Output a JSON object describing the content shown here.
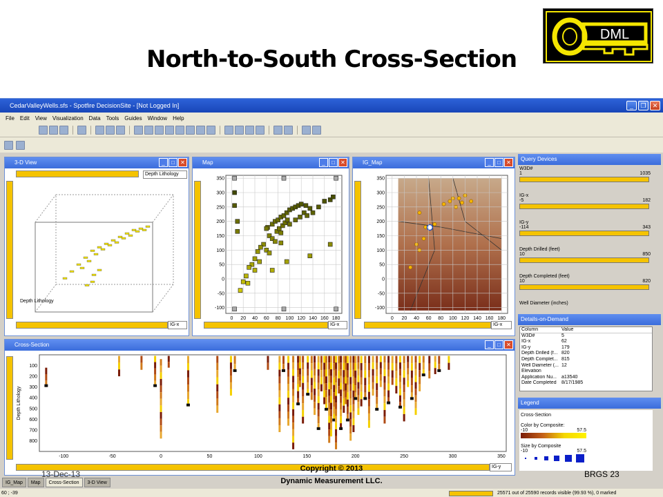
{
  "slide": {
    "title": "North-to-South Cross-Section",
    "logo_text": "DML",
    "footer_date": "13-Dec-13",
    "footer_copyright_line1": "Copyright © 2013",
    "footer_copyright_line2": "Dynamic Measurement LLC.",
    "footer_page": "BRGS  23"
  },
  "app": {
    "title": "CedarValleyWells.sfs - Spotfire DecisionSite - [Not Logged In]",
    "menu": [
      "File",
      "Edit",
      "View",
      "Visualization",
      "Data",
      "Tools",
      "Guides",
      "Window",
      "Help"
    ]
  },
  "panels": {
    "view3d": {
      "title": "3-D View",
      "color_by": "Depth Lithology",
      "x_axis": "IG-x",
      "z_label": "Depth Lithology"
    },
    "map": {
      "title": "Map",
      "x_axis": "IG-x",
      "y_axis": "IG-y"
    },
    "ig_map": {
      "title": "IG_Map",
      "x_axis": "IG-x",
      "y_axis": "IG-y"
    },
    "cross_section": {
      "title": "Cross-Section",
      "x_axis": "IG-y",
      "y_axis": "Depth Lithology"
    }
  },
  "chart_data": [
    {
      "type": "scatter",
      "title": "Map",
      "xlabel": "IG-x",
      "ylabel": "IG-y",
      "xlim": [
        -10,
        190
      ],
      "ylim": [
        -120,
        360
      ],
      "x_ticks": [
        0,
        20,
        40,
        60,
        80,
        100,
        120,
        140,
        160,
        180
      ],
      "y_ticks": [
        -100,
        -50,
        0,
        50,
        100,
        150,
        200,
        250,
        300,
        350
      ],
      "points": [
        [
          62,
          179
        ],
        [
          70,
          190
        ],
        [
          75,
          200
        ],
        [
          80,
          205
        ],
        [
          85,
          215
        ],
        [
          90,
          220
        ],
        [
          95,
          230
        ],
        [
          100,
          240
        ],
        [
          105,
          245
        ],
        [
          110,
          250
        ],
        [
          115,
          255
        ],
        [
          120,
          260
        ],
        [
          128,
          255
        ],
        [
          135,
          245
        ],
        [
          140,
          230
        ],
        [
          150,
          250
        ],
        [
          160,
          270
        ],
        [
          170,
          275
        ],
        [
          175,
          285
        ],
        [
          65,
          150
        ],
        [
          70,
          140
        ],
        [
          75,
          130
        ],
        [
          78,
          165
        ],
        [
          82,
          175
        ],
        [
          88,
          185
        ],
        [
          92,
          195
        ],
        [
          96,
          205
        ],
        [
          55,
          120
        ],
        [
          50,
          110
        ],
        [
          45,
          95
        ],
        [
          40,
          70
        ],
        [
          35,
          50
        ],
        [
          30,
          40
        ],
        [
          40,
          30
        ],
        [
          48,
          60
        ],
        [
          25,
          10
        ],
        [
          20,
          -10
        ],
        [
          15,
          -40
        ],
        [
          28,
          -15
        ],
        [
          60,
          100
        ],
        [
          65,
          90
        ],
        [
          85,
          160
        ],
        [
          100,
          190
        ],
        [
          110,
          205
        ],
        [
          118,
          215
        ],
        [
          125,
          230
        ],
        [
          130,
          220
        ],
        [
          60,
          175
        ],
        [
          10,
          165
        ],
        [
          10,
          200
        ],
        [
          5,
          255
        ],
        [
          5,
          300
        ],
        [
          85,
          125
        ],
        [
          5,
          -105
        ],
        [
          5,
          350
        ],
        [
          180,
          350
        ],
        [
          180,
          -105
        ],
        [
          90,
          -105
        ],
        [
          90,
          350
        ],
        [
          170,
          120
        ],
        [
          135,
          80
        ],
        [
          95,
          60
        ],
        [
          70,
          30
        ]
      ]
    },
    {
      "type": "scatter",
      "title": "IG_Map",
      "xlabel": "IG-x",
      "ylabel": "IG-y",
      "xlim": [
        -10,
        190
      ],
      "ylim": [
        -120,
        360
      ],
      "x_ticks": [
        0,
        20,
        40,
        60,
        80,
        100,
        120,
        140,
        160,
        180
      ],
      "y_ticks": [
        -100,
        -50,
        0,
        50,
        100,
        150,
        200,
        250,
        300,
        350
      ]
    },
    {
      "type": "bar",
      "title": "Cross-Section",
      "xlabel": "IG-y",
      "ylabel": "Depth Lithology",
      "xlim": [
        -125,
        355
      ],
      "ylim": [
        900,
        0
      ],
      "x_ticks": [
        -100,
        -50,
        0,
        50,
        100,
        150,
        200,
        250,
        300,
        350
      ],
      "y_ticks": [
        100,
        200,
        300,
        400,
        500,
        600,
        700,
        800
      ],
      "wells": [
        [
          -118,
          120,
          300
        ],
        [
          -43,
          10,
          200
        ],
        [
          -20,
          10,
          140
        ],
        [
          -6,
          10,
          300
        ],
        [
          0,
          40,
          780
        ],
        [
          8,
          10,
          120
        ],
        [
          28,
          10,
          480
        ],
        [
          58,
          10,
          540
        ],
        [
          72,
          10,
          380
        ],
        [
          76,
          10,
          160
        ],
        [
          110,
          10,
          140
        ],
        [
          122,
          10,
          720
        ],
        [
          126,
          10,
          160
        ],
        [
          131,
          10,
          660
        ],
        [
          136,
          10,
          880
        ],
        [
          141,
          10,
          470
        ],
        [
          143,
          10,
          300
        ],
        [
          146,
          10,
          640
        ],
        [
          151,
          10,
          380
        ],
        [
          155,
          10,
          420
        ],
        [
          158,
          10,
          560
        ],
        [
          162,
          10,
          700
        ],
        [
          165,
          10,
          340
        ],
        [
          168,
          10,
          460
        ],
        [
          170,
          10,
          520
        ],
        [
          173,
          10,
          820
        ],
        [
          175,
          10,
          760
        ],
        [
          178,
          10,
          620
        ],
        [
          180,
          10,
          880
        ],
        [
          183,
          10,
          360
        ],
        [
          185,
          10,
          700
        ],
        [
          188,
          10,
          540
        ],
        [
          190,
          10,
          460
        ],
        [
          192,
          10,
          620
        ],
        [
          195,
          10,
          800
        ],
        [
          198,
          10,
          720
        ],
        [
          200,
          10,
          420
        ],
        [
          203,
          10,
          560
        ],
        [
          206,
          10,
          480
        ],
        [
          210,
          10,
          420
        ],
        [
          214,
          10,
          680
        ],
        [
          218,
          10,
          380
        ],
        [
          222,
          10,
          520
        ],
        [
          226,
          10,
          300
        ],
        [
          230,
          10,
          640
        ],
        [
          234,
          10,
          460
        ],
        [
          238,
          10,
          280
        ],
        [
          242,
          10,
          360
        ],
        [
          246,
          10,
          500
        ],
        [
          250,
          10,
          620
        ],
        [
          254,
          10,
          300
        ],
        [
          258,
          10,
          420
        ],
        [
          262,
          10,
          560
        ],
        [
          266,
          10,
          340
        ],
        [
          270,
          10,
          200
        ],
        [
          276,
          10,
          220
        ],
        [
          282,
          10,
          180
        ],
        [
          286,
          10,
          160
        ],
        [
          296,
          10,
          140
        ]
      ]
    }
  ],
  "query_devices": {
    "title": "Query Devices",
    "items": [
      {
        "label": "W3D#",
        "min": "1",
        "max": "1035"
      },
      {
        "label": "IG-x",
        "min": "-5",
        "max": "182"
      },
      {
        "label": "IG-y",
        "min": "-114",
        "max": "343"
      },
      {
        "label": "Depth Drilled (feet)",
        "min": "10",
        "max": "850"
      },
      {
        "label": "Depth Completed (feet)",
        "min": "10",
        "max": "820"
      },
      {
        "label": "Well Diameter (inches)",
        "min": "",
        "max": ""
      }
    ]
  },
  "details_on_demand": {
    "title": "Details-on-Demand",
    "col_header": "Column",
    "val_header": "Value",
    "rows": [
      [
        "W3D#",
        "5"
      ],
      [
        "IG-x",
        "62"
      ],
      [
        "IG-y",
        "179"
      ],
      [
        "Depth Drilled (f...",
        "820"
      ],
      [
        "Depth Complet...",
        "815"
      ],
      [
        "Well Diameter (...",
        "12"
      ],
      [
        "Elevation",
        ""
      ],
      [
        "Application Nu...",
        "a13540"
      ],
      [
        "Date Completed",
        "8/17/1985"
      ]
    ]
  },
  "legend": {
    "title": "Legend",
    "subtitle": "Cross-Section",
    "color_label": "Color by Composite:",
    "color_min": "-10",
    "color_max": "57.5",
    "size_label": "Size by Composite",
    "size_min": "-10",
    "size_max": "57.5"
  },
  "tabs": [
    "IG_Map",
    "Map",
    "Cross-Section",
    "3-D View"
  ],
  "status": {
    "coords": "60 ; -39",
    "records": "25571 out of 25590 records visible (99.93 %), 0 marked"
  }
}
